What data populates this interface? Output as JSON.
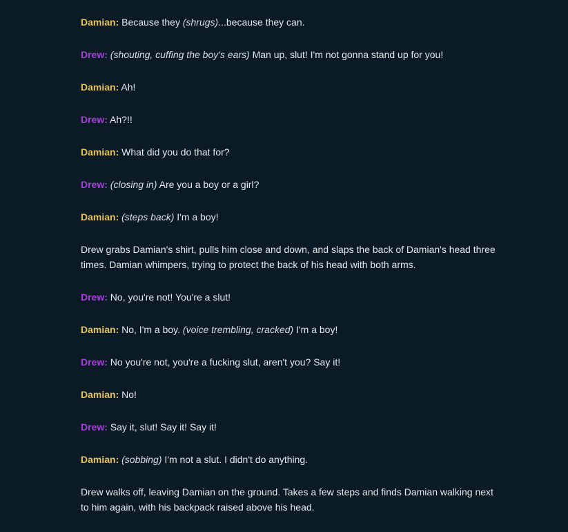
{
  "colors": {
    "background": "#0b1b26",
    "text": "#e4e8ec",
    "damian": "#e8c25a",
    "drew": "#a63fd9"
  },
  "lines": [
    {
      "speaker": "Damian:",
      "segments": [
        {
          "t": "Because they "
        },
        {
          "t": "(shrugs)",
          "i": true
        },
        {
          "t": "...because they can."
        }
      ]
    },
    {
      "speaker": "Drew:",
      "segments": [
        {
          "t": "(shouting, cuffing the boy's ears)",
          "i": true
        },
        {
          "t": " Man up, slut! I'm not gonna stand up for you!"
        }
      ]
    },
    {
      "speaker": "Damian:",
      "segments": [
        {
          "t": "Ah!"
        }
      ]
    },
    {
      "speaker": "Drew:",
      "segments": [
        {
          "t": "Ah?!!"
        }
      ]
    },
    {
      "speaker": "Damian:",
      "segments": [
        {
          "t": "What did you do that for?"
        }
      ]
    },
    {
      "speaker": "Drew:",
      "segments": [
        {
          "t": "(closing in)",
          "i": true
        },
        {
          "t": " Are you a boy or a girl?"
        }
      ]
    },
    {
      "speaker": "Damian:",
      "segments": [
        {
          "t": "(steps back)",
          "i": true
        },
        {
          "t": " I'm a boy!"
        }
      ]
    },
    {
      "speaker": null,
      "segments": [
        {
          "t": "Drew grabs Damian's shirt, pulls him close and down, and slaps the back of Damian's head three times. Damian whimpers, trying to protect the back of his head with both arms."
        }
      ]
    },
    {
      "speaker": "Drew:",
      "segments": [
        {
          "t": "No, you're not! You're a slut!"
        }
      ]
    },
    {
      "speaker": "Damian:",
      "segments": [
        {
          "t": "No, I'm a boy. "
        },
        {
          "t": "(voice trembling, cracked)",
          "i": true
        },
        {
          "t": " I'm a boy!"
        }
      ]
    },
    {
      "speaker": "Drew:",
      "segments": [
        {
          "t": "No you're not, you're a fucking slut, aren't you? Say it!"
        }
      ]
    },
    {
      "speaker": "Damian:",
      "segments": [
        {
          "t": "No!"
        }
      ]
    },
    {
      "speaker": "Drew:",
      "segments": [
        {
          "t": "Say it, slut! Say it! Say it!"
        }
      ]
    },
    {
      "speaker": "Damian:",
      "segments": [
        {
          "t": "(sobbing)",
          "i": true
        },
        {
          "t": " I'm not a slut. I didn't do anything."
        }
      ]
    },
    {
      "speaker": null,
      "segments": [
        {
          "t": "Drew walks off, leaving Damian on the ground. Takes a few steps and finds Damian walking next to him again, with his backpack raised above his head."
        }
      ]
    }
  ]
}
